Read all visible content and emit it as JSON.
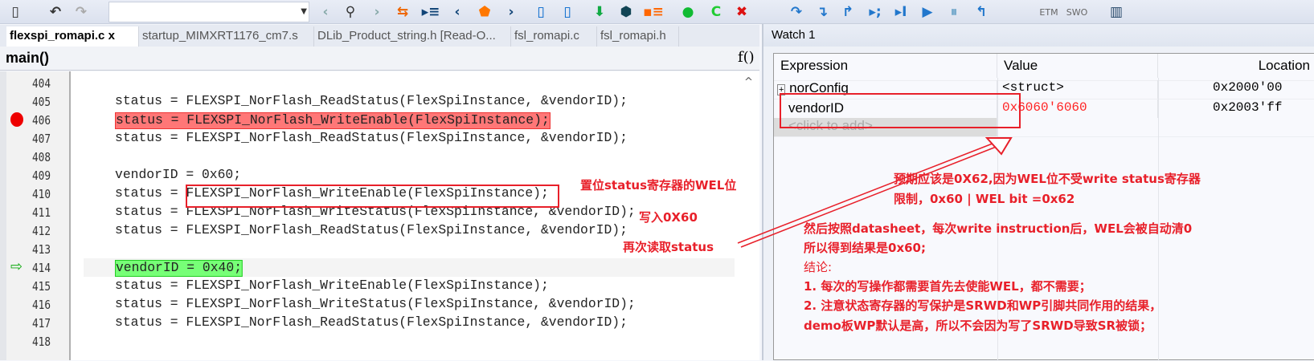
{
  "toolbar": {
    "icons": [
      "new-file-icon",
      "undo-icon",
      "redo-icon",
      "nav-back-icon",
      "find-icon",
      "nav-forward-icon",
      "toggle-icon",
      "bookmark-icon",
      "prev-icon",
      "bookmark-flag-icon",
      "next-icon",
      "prev-bookmark-icon",
      "next-bookmark-icon",
      "download-icon",
      "download-debug-icon",
      "breakpoints-icon",
      "make-icon",
      "rebuild-icon",
      "stop-build-icon",
      "step-over-icon",
      "step-into-icon",
      "step-out-icon",
      "next-statement-icon",
      "run-to-cursor-icon",
      "go-icon",
      "break-icon",
      "reset-icon"
    ],
    "etm": "ETM",
    "swo": "SWO",
    "search_value": ""
  },
  "tabs": [
    {
      "label": "flexspi_romapi.c",
      "active": true,
      "close": "x"
    },
    {
      "label": "startup_MIMXRT1176_cm7.s"
    },
    {
      "label": "DLib_Product_string.h [Read-O..."
    },
    {
      "label": "fsl_romapi.c"
    },
    {
      "label": "fsl_romapi.h"
    }
  ],
  "editor": {
    "function": "main()",
    "fx": "f()",
    "lines": [
      {
        "n": "404",
        "code": ""
      },
      {
        "n": "405",
        "code": "status = FLEXSPI_NorFlash_ReadStatus(FlexSpiInstance, &vendorID);"
      },
      {
        "n": "406",
        "code": "status = FLEXSPI_NorFlash_WriteEnable(FlexSpiInstance);",
        "breakpoint": true
      },
      {
        "n": "407",
        "code": "status = FLEXSPI_NorFlash_ReadStatus(FlexSpiInstance, &vendorID);"
      },
      {
        "n": "408",
        "code": ""
      },
      {
        "n": "409",
        "code": "vendorID = 0x60;"
      },
      {
        "n": "410",
        "code": "status = FLEXSPI_NorFlash_WriteEnable(FlexSpiInstance);"
      },
      {
        "n": "411",
        "code": "status = FLEXSPI_NorFlash_WriteStatus(FlexSpiInstance, &vendorID);"
      },
      {
        "n": "412",
        "code": "status = FLEXSPI_NorFlash_ReadStatus(FlexSpiInstance, &vendorID);"
      },
      {
        "n": "413",
        "code": ""
      },
      {
        "n": "414",
        "code": "vendorID = 0x40;",
        "current": true
      },
      {
        "n": "415",
        "code": "status = FLEXSPI_NorFlash_WriteEnable(FlexSpiInstance);"
      },
      {
        "n": "416",
        "code": "status = FLEXSPI_NorFlash_WriteStatus(FlexSpiInstance, &vendorID);"
      },
      {
        "n": "417",
        "code": "status = FLEXSPI_NorFlash_ReadStatus(FlexSpiInstance, &vendorID);"
      },
      {
        "n": "418",
        "code": ""
      }
    ]
  },
  "watch": {
    "title": "Watch 1",
    "headers": [
      "Expression",
      "Value",
      "Location"
    ],
    "rows": [
      {
        "expr": "norConfig",
        "value": "<struct>",
        "loc": "0x2000'00",
        "expand": "+"
      },
      {
        "expr": "vendorID",
        "value": "0x6060'6060",
        "loc": "0x2003'ff",
        "changed": true
      },
      {
        "expr": "<click to add>",
        "value": "",
        "loc": ""
      }
    ]
  },
  "annotations": {
    "wel": "置位status寄存器的WEL位",
    "write": "写入0X60",
    "read": "再次读取status",
    "expect1": "预期应该是0X62,因为WEL位不受write status寄存器",
    "expect2": "限制，0x60 | WEL bit =0x62",
    "then1": "然后按照datasheet，每次write instruction后，WEL会被自动清0",
    "then2": "所以得到结果是0x60;",
    "concl": "结论:",
    "c1": "1. 每次的写操作都需要首先去使能WEL，都不需要；",
    "c2": "2. 注意状态寄存器的写保护是SRWD和WP引脚共同作用的结果，",
    "c3": "demo板WP默认是高，所以不会因为写了SRWD导致SR被锁；"
  },
  "colors": {
    "annotation": "#e8202a",
    "breakpoint": "#ff6b6b",
    "current": "#77ff77"
  }
}
